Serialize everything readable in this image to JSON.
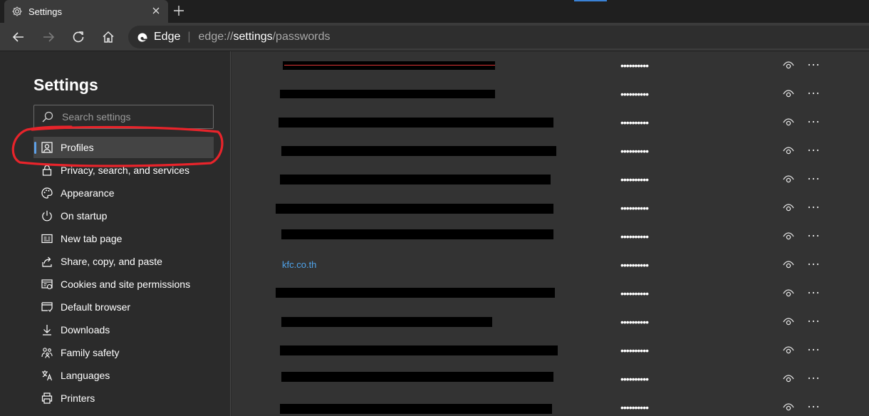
{
  "tab": {
    "title": "Settings"
  },
  "address": {
    "site": "Edge",
    "url_prefix": "edge://",
    "url_bold": "settings",
    "url_suffix": "/passwords"
  },
  "sidebar": {
    "title": "Settings",
    "search_placeholder": "Search settings",
    "items": [
      {
        "label": "Profiles",
        "icon": "profile-icon",
        "active": true
      },
      {
        "label": "Privacy, search, and services",
        "icon": "lock-icon"
      },
      {
        "label": "Appearance",
        "icon": "palette-icon"
      },
      {
        "label": "On startup",
        "icon": "power-icon"
      },
      {
        "label": "New tab page",
        "icon": "newtab-icon"
      },
      {
        "label": "Share, copy, and paste",
        "icon": "share-icon"
      },
      {
        "label": "Cookies and site permissions",
        "icon": "cookies-icon"
      },
      {
        "label": "Default browser",
        "icon": "browser-icon"
      },
      {
        "label": "Downloads",
        "icon": "download-icon"
      },
      {
        "label": "Family safety",
        "icon": "family-icon"
      },
      {
        "label": "Languages",
        "icon": "language-icon"
      },
      {
        "label": "Printers",
        "icon": "printer-icon"
      }
    ]
  },
  "passwords": {
    "masked": "••••••••••",
    "visible_site": "kfc.co.th"
  },
  "colors": {
    "accent": "#5ea0e6",
    "link": "#4fa3ea",
    "annotation": "#e8242b"
  }
}
